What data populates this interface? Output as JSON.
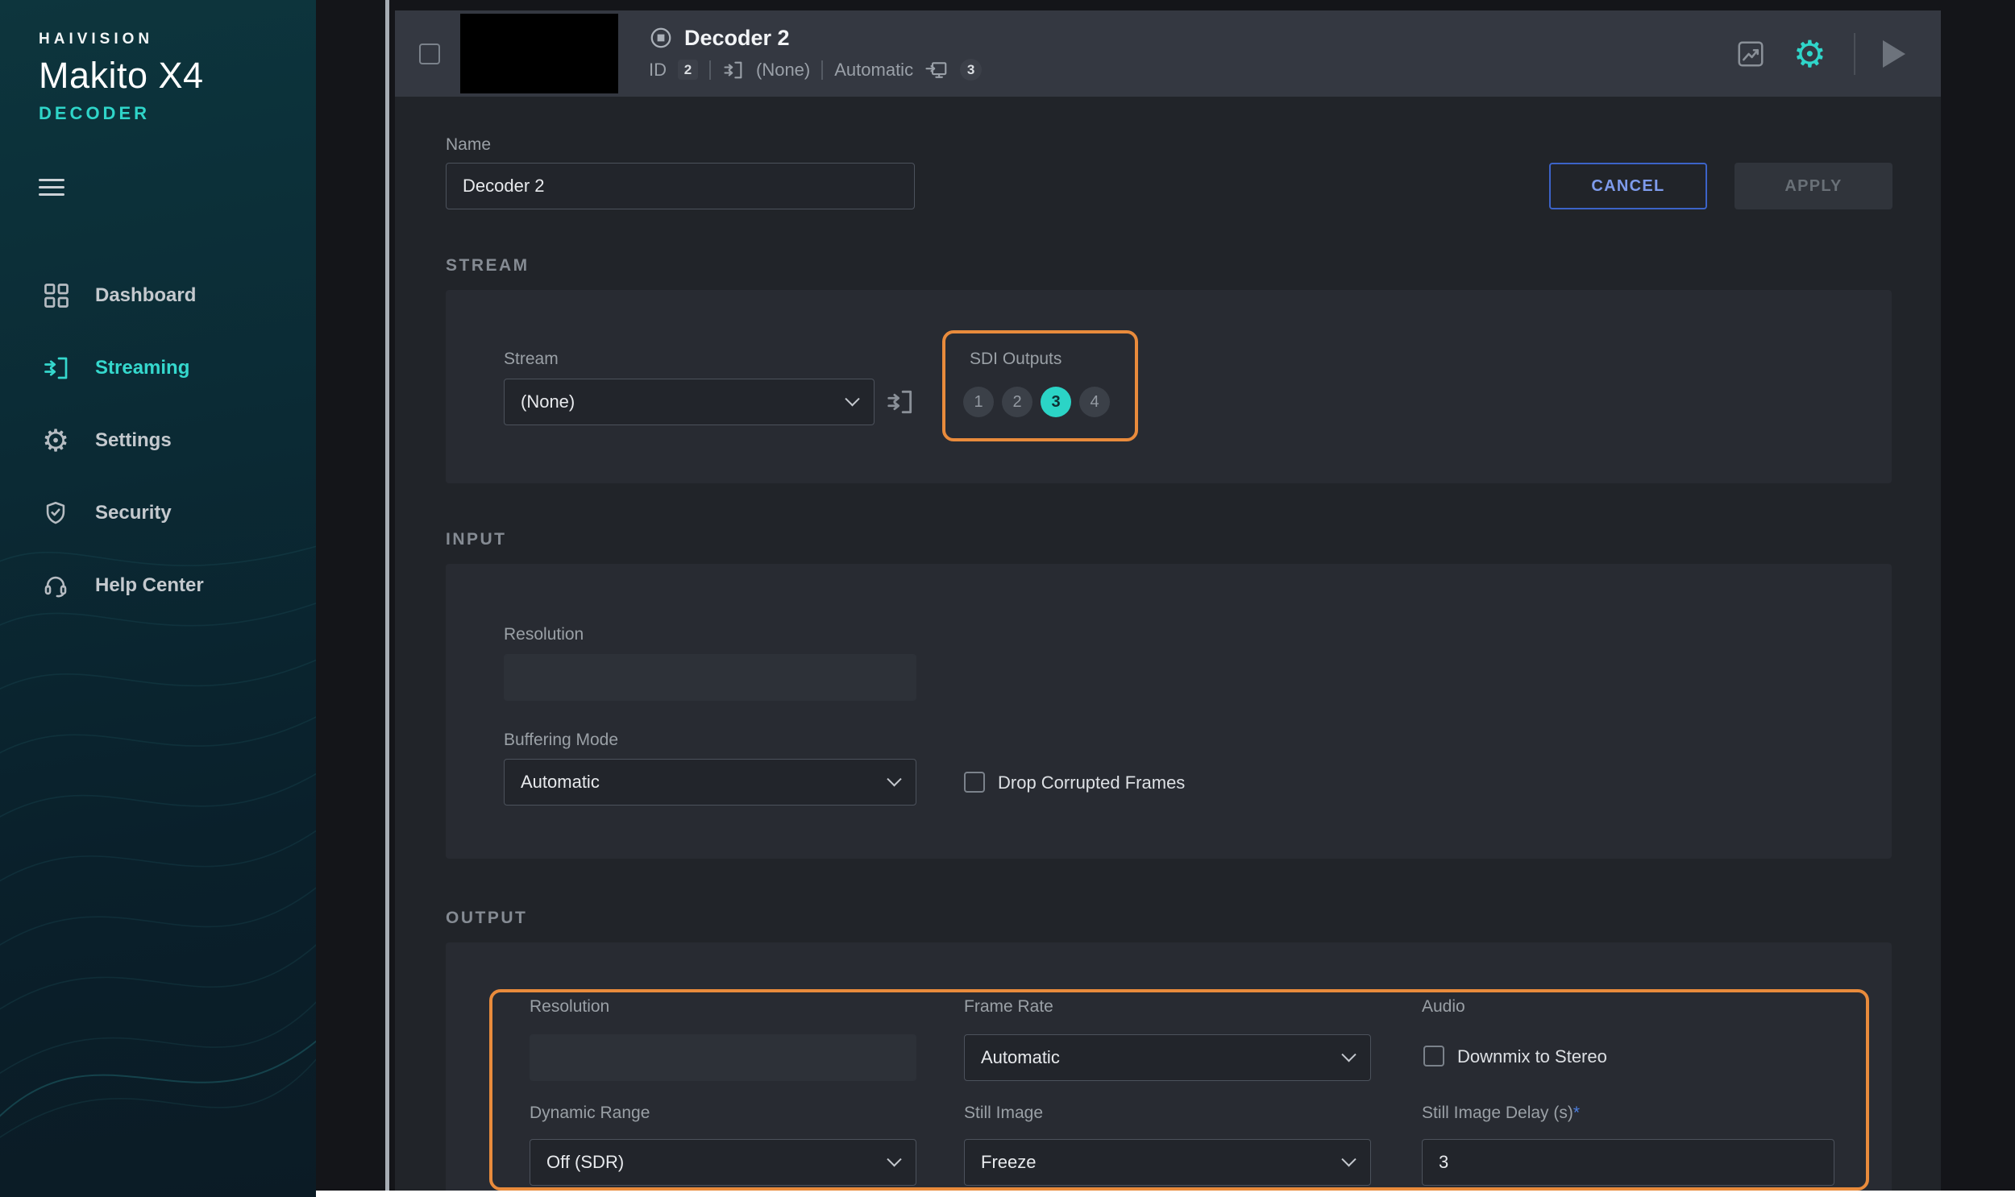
{
  "brand": {
    "name": "HAIVISION",
    "product": "Makito X4",
    "subtitle": "DECODER"
  },
  "sidebar": {
    "items": [
      {
        "label": "Dashboard"
      },
      {
        "label": "Streaming"
      },
      {
        "label": "Settings"
      },
      {
        "label": "Security"
      },
      {
        "label": "Help Center"
      }
    ]
  },
  "header": {
    "title": "Decoder 2",
    "id_label": "ID",
    "id_value": "2",
    "stream_value": "(None)",
    "mode_value": "Automatic",
    "output_count": "3"
  },
  "form": {
    "name_label": "Name",
    "name_value": "Decoder 2",
    "cancel_label": "CANCEL",
    "apply_label": "APPLY"
  },
  "stream_section": {
    "heading": "STREAM",
    "stream_label": "Stream",
    "stream_value": "(None)",
    "sdi_outputs_label": "SDI Outputs",
    "sdi_outputs": [
      "1",
      "2",
      "3",
      "4"
    ],
    "sdi_selected": "3"
  },
  "input_section": {
    "heading": "INPUT",
    "resolution_label": "Resolution",
    "resolution_value": "",
    "buffering_mode_label": "Buffering Mode",
    "buffering_mode_value": "Automatic",
    "drop_corrupted_frames_label": "Drop Corrupted Frames"
  },
  "output_section": {
    "heading": "OUTPUT",
    "resolution_label": "Resolution",
    "resolution_value": "",
    "frame_rate_label": "Frame Rate",
    "frame_rate_value": "Automatic",
    "audio_label": "Audio",
    "downmix_label": "Downmix to Stereo",
    "dynamic_range_label": "Dynamic Range",
    "dynamic_range_value": "Off (SDR)",
    "still_image_label": "Still Image",
    "still_image_value": "Freeze",
    "still_image_delay_label": "Still Image Delay (s)",
    "required_marker": "*",
    "still_image_delay_value": "3"
  },
  "colors": {
    "accent_teal": "#2fd5c9",
    "annotation_orange": "#e98b3c",
    "cancel_blue": "#4d7fe0"
  }
}
